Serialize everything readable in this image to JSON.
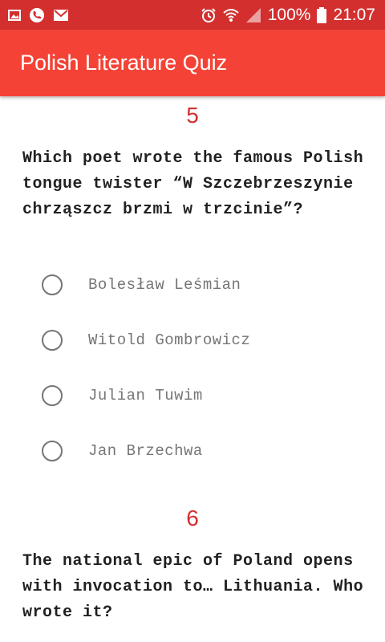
{
  "status_bar": {
    "battery": "100%",
    "time": "21:07",
    "left_icons": [
      "image-icon",
      "phone-icon",
      "gmail-icon"
    ],
    "right_icons": [
      "alarm-icon",
      "wifi-icon",
      "signal-icon",
      "battery-icon"
    ]
  },
  "app_bar": {
    "title": "Polish Literature Quiz",
    "color": "#f44336"
  },
  "questions": [
    {
      "number": "5",
      "text": "Which poet wrote the famous Polish tongue twister “W Szczebrzeszynie chrząszcz brzmi w trzcinie”?",
      "options": [
        "Bolesław Leśmian",
        "Witold Gombrowicz",
        "Julian Tuwim",
        "Jan Brzechwa"
      ]
    },
    {
      "number": "6",
      "text": "The national epic of Poland opens with invocation to… Lithuania. Who wrote it?"
    }
  ],
  "colors": {
    "status_bar": "#d32f2f",
    "accent": "#d32f2f",
    "radio": "#757575"
  }
}
